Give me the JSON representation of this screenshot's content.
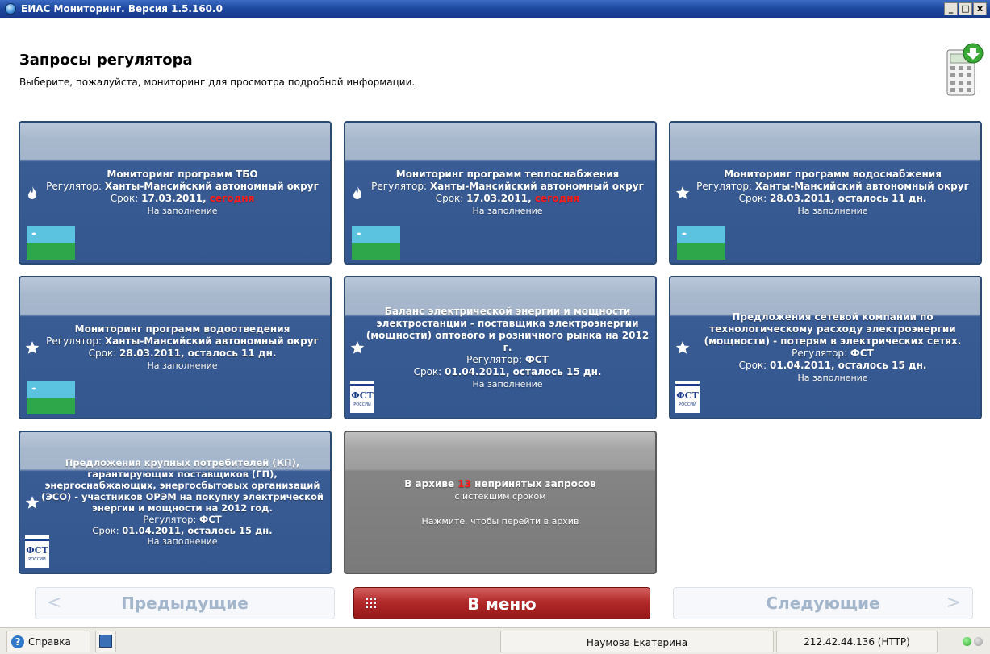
{
  "window": {
    "title": "ЕИАС Мониторинг. Версия 1.5.160.0",
    "buttons": [
      "_",
      "□",
      "x"
    ]
  },
  "header": {
    "title": "Запросы регулятора",
    "subtitle": "Выберите, пожалуйста, мониторинг для просмотра подробной информации."
  },
  "tiles": [
    {
      "title": "Мониторинг программ ТБО",
      "regulator_label": "Регулятор: ",
      "regulator": "Ханты-Мансийский автономный округ",
      "deadline_label": "Срок: ",
      "deadline": "17.03.2011, ",
      "remaining": "сегодня",
      "status": "На заполнение",
      "icon": "flame-icon",
      "logo": "flag-icon"
    },
    {
      "title": "Мониторинг программ теплоснабжения",
      "regulator_label": "Регулятор: ",
      "regulator": "Ханты-Мансийский автономный округ",
      "deadline_label": "Срок: ",
      "deadline": "17.03.2011, ",
      "remaining": "сегодня",
      "status": "На заполнение",
      "icon": "flame-icon",
      "logo": "flag-icon"
    },
    {
      "title": "Мониторинг программ водоснабжения",
      "regulator_label": "Регулятор: ",
      "regulator": "Ханты-Мансийский автономный округ",
      "deadline_label": "Срок: ",
      "deadline": "28.03.2011, осталось 11 дн.",
      "remaining": "",
      "status": "На заполнение",
      "icon": "star-icon",
      "logo": "flag-icon"
    },
    {
      "title": "Мониторинг программ водоотведения",
      "regulator_label": "Регулятор: ",
      "regulator": "Ханты-Мансийский автономный округ",
      "deadline_label": "Срок: ",
      "deadline": "28.03.2011, осталось 11 дн.",
      "remaining": "",
      "status": "На заполнение",
      "icon": "star-icon",
      "logo": "flag-icon"
    },
    {
      "title": "Баланс электрической энергии и мощности электростанции - поставщика электроэнергии (мощности) оптового и розничного рынка на 2012 г.",
      "regulator_label": "Регулятор: ",
      "regulator": "ФСТ",
      "deadline_label": "Срок: ",
      "deadline": "01.04.2011, осталось 15 дн.",
      "remaining": "",
      "status": "На заполнение",
      "icon": "star-icon",
      "logo": "fst-logo"
    },
    {
      "title": "Предложения сетевой компании по технологическому расходу электроэнергии (мощности) - потерям в электрических сетях.",
      "regulator_label": "Регулятор: ",
      "regulator": "ФСТ",
      "deadline_label": "Срок: ",
      "deadline": "01.04.2011, осталось 15 дн.",
      "remaining": "",
      "status": "На заполнение",
      "icon": "star-icon",
      "logo": "fst-logo"
    },
    {
      "title": "Предложения крупных потребителей (КП), гарантирующих поставщиков (ГП), энергоснабжающих, энергосбытовых организаций (ЭСО) - участников ОРЭМ на покупку электрической энергии и мощности на 2012 год.",
      "regulator_label": "Регулятор: ",
      "regulator": "ФСТ",
      "deadline_label": "Срок: ",
      "deadline": "01.04.2011, осталось 15 дн.",
      "remaining": "",
      "status": "На заполнение",
      "icon": "star-icon",
      "logo": "fst-logo"
    }
  ],
  "fst_logo_text": "ФСТ",
  "fst_logo_subtext": "РОССИИ",
  "archive": {
    "prefix": "В архиве ",
    "count": "13",
    "suffix": " непринятых запросов",
    "line2": "с истекшим сроком",
    "action": "Нажмите, чтобы перейти в архив"
  },
  "nav": {
    "prev_label": "Предыдущие",
    "prev_arrow": "<",
    "menu_label": "В меню",
    "next_label": "Следующие",
    "next_arrow": ">"
  },
  "statusbar": {
    "help_label": "Справка",
    "help_glyph": "?",
    "user": "Наумова Екатерина",
    "server": "212.42.44.136 (HTTP)"
  },
  "colors": {
    "tile_bg": "#34578f",
    "archive_bg": "#7a7a7a",
    "menu_button": "#b32a2a",
    "deadline_today": "#ff1c1c",
    "status_led": "#2ea82a"
  }
}
